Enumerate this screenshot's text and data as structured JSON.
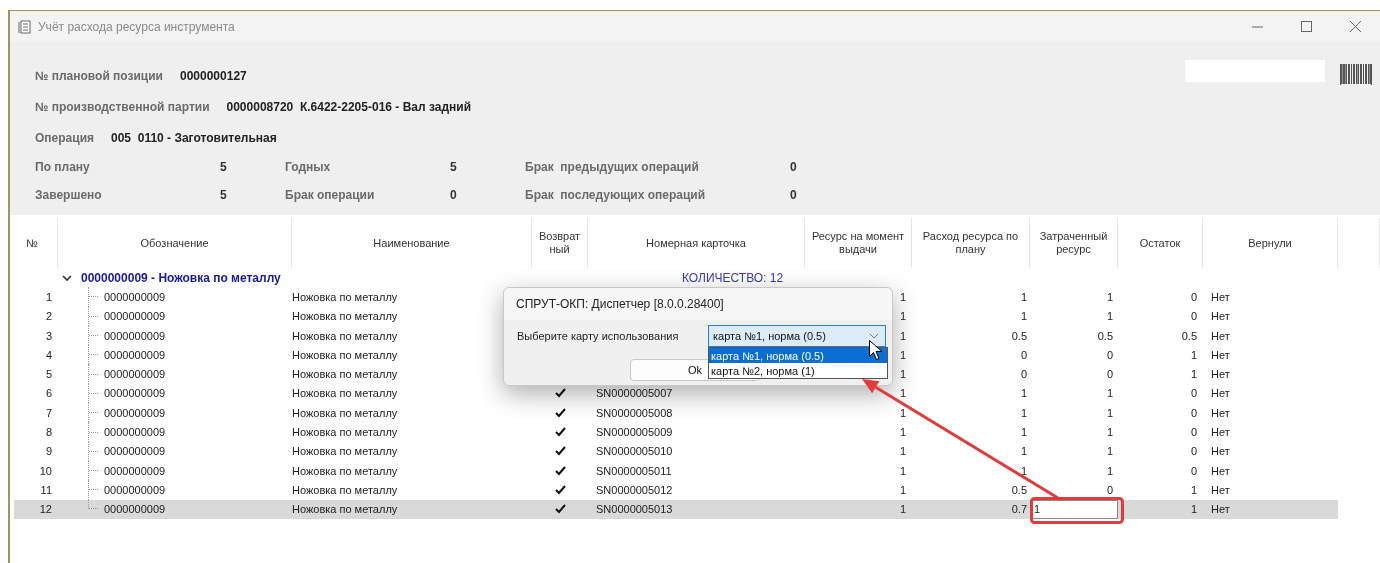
{
  "window": {
    "title": "Учёт расхода ресурса инструмента"
  },
  "header": {
    "fields": [
      {
        "label": "№ плановой позиции",
        "value": "0000000127"
      },
      {
        "label": "№ производственной партии",
        "value": "0000008720  К.6422-2205-016 - Вал задний"
      },
      {
        "label": "Операция",
        "value": "005  0110 - Заготовительная"
      }
    ],
    "stats": [
      [
        {
          "label": "По плану",
          "value": "5"
        },
        {
          "label": "Годных",
          "value": "5"
        },
        {
          "label": "Брак  предыдущих операций",
          "value": "0"
        }
      ],
      [
        {
          "label": "Завершено",
          "value": "5"
        },
        {
          "label": "Брак операции",
          "value": "0"
        },
        {
          "label": "Брак  последующих операций",
          "value": "0"
        }
      ]
    ]
  },
  "table": {
    "columns": [
      "№",
      "Обозначение",
      "Наименование",
      "Возврат ный",
      "Номерная карточка",
      "Ресурс на момент выдачи",
      "Расход ресурса по плану",
      "Затраченный ресурс",
      "Остаток",
      "Вернули"
    ],
    "groups": [
      {
        "title": "0000000009 - Ножовка по металлу",
        "count": "КОЛИЧЕСТВО: 12",
        "expanded": true,
        "children": [
          {
            "number": "1",
            "designation": "0000000009",
            "name": "Ножовка по металлу",
            "issued": "1",
            "planned": "1",
            "spent": "1",
            "remaining": "0",
            "returned_text": "Нет",
            "selected": false,
            "editing": false
          },
          {
            "number": "2",
            "designation": "0000000009",
            "name": "Ножовка по металлу",
            "issued": "1",
            "planned": "1",
            "spent": "1",
            "remaining": "0",
            "returned_text": "Нет",
            "selected": false,
            "editing": false
          },
          {
            "number": "3",
            "designation": "0000000009",
            "name": "Ножовка по металлу",
            "issued": "1",
            "planned": "0.5",
            "spent": "0.5",
            "remaining": "0.5",
            "returned_text": "Нет",
            "selected": false,
            "editing": false
          },
          {
            "number": "4",
            "designation": "0000000009",
            "name": "Ножовка по металлу",
            "issued": "1",
            "planned": "0",
            "spent": "0",
            "remaining": "1",
            "returned_text": "Нет",
            "selected": false,
            "editing": false
          },
          {
            "number": "5",
            "designation": "0000000009",
            "name": "Ножовка по металлу",
            "issued": "1",
            "planned": "0",
            "spent": "0",
            "remaining": "1",
            "returned_text": "Нет",
            "selected": false,
            "editing": false
          },
          {
            "number": "6",
            "designation": "0000000009",
            "name": "Ножовка по металлу",
            "returned": true,
            "card": "SN0000005007",
            "issued": "1",
            "planned": "1",
            "spent": "1",
            "remaining": "0",
            "returned_text": "Нет",
            "selected": false,
            "editing": false
          },
          {
            "number": "7",
            "designation": "0000000009",
            "name": "Ножовка по металлу",
            "returned": true,
            "card": "SN0000005008",
            "issued": "1",
            "planned": "1",
            "spent": "1",
            "remaining": "0",
            "returned_text": "Нет",
            "selected": false,
            "editing": false
          },
          {
            "number": "8",
            "designation": "0000000009",
            "name": "Ножовка по металлу",
            "returned": true,
            "card": "SN0000005009",
            "issued": "1",
            "planned": "1",
            "spent": "1",
            "remaining": "0",
            "returned_text": "Нет",
            "selected": false,
            "editing": false
          },
          {
            "number": "9",
            "designation": "0000000009",
            "name": "Ножовка по металлу",
            "returned": true,
            "card": "SN0000005010",
            "issued": "1",
            "planned": "1",
            "spent": "1",
            "remaining": "0",
            "returned_text": "Нет",
            "selected": false,
            "editing": false
          },
          {
            "number": "10",
            "designation": "0000000009",
            "name": "Ножовка по металлу",
            "returned": true,
            "card": "SN0000005011",
            "issued": "1",
            "planned": "1",
            "spent": "1",
            "remaining": "0",
            "returned_text": "Нет",
            "selected": false,
            "editing": false
          },
          {
            "number": "11",
            "designation": "0000000009",
            "name": "Ножовка по металлу",
            "returned": true,
            "card": "SN0000005012",
            "issued": "1",
            "planned": "0.5",
            "spent": "0",
            "remaining": "1",
            "returned_text": "Нет",
            "selected": false,
            "editing": false
          },
          {
            "number": "12",
            "designation": "0000000009",
            "name": "Ножовка по металлу",
            "returned": true,
            "card": "SN0000005013",
            "issued": "1",
            "planned": "0.7",
            "spent": "1",
            "remaining": "1",
            "returned_text": "Нет",
            "selected": true,
            "editing": true
          }
        ]
      }
    ]
  },
  "dialog": {
    "title": "СПРУТ-ОКП: Диспетчер [8.0.0.28400]",
    "label": "Выберите карту использования",
    "combo": {
      "value": "карта №1, норма (0.5)",
      "expanded": true,
      "options": [
        {
          "label": "карта №1, норма (0.5)",
          "selected": true
        },
        {
          "label": "карта №2, норма (1)",
          "selected": false
        }
      ]
    },
    "buttons": [
      "Ok"
    ]
  }
}
